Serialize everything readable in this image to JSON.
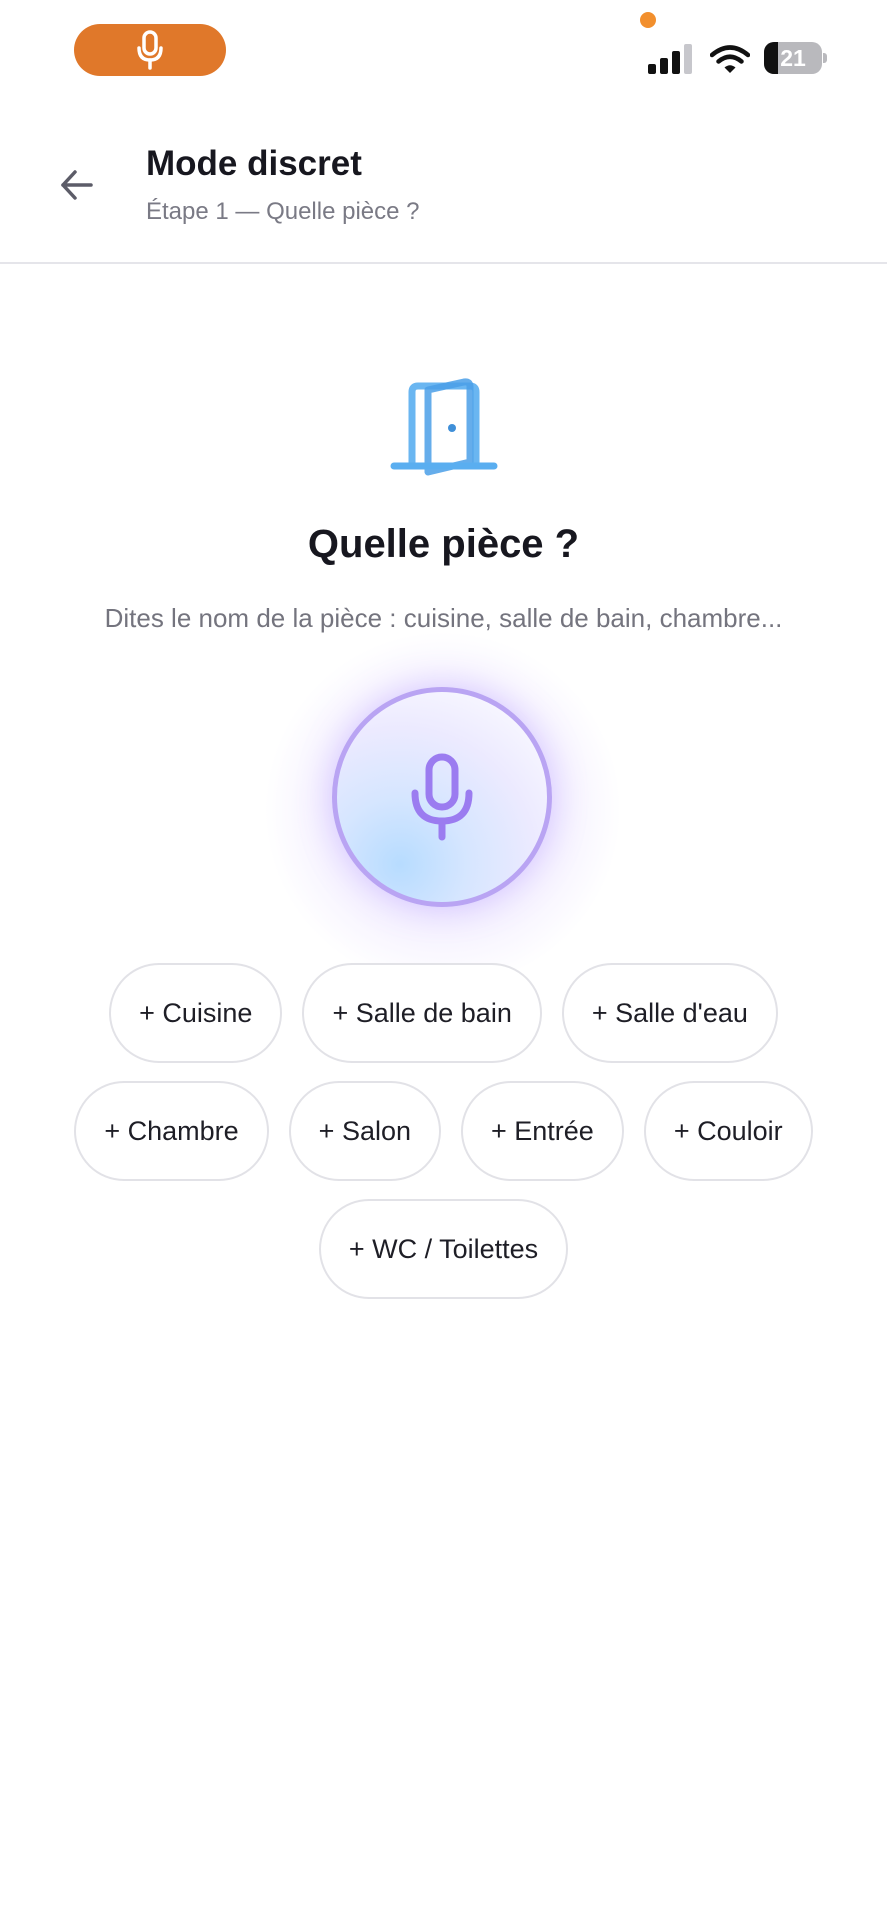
{
  "status_bar": {
    "battery_level": "21",
    "recording_indicator_color": "#e0782a",
    "privacy_dot_color": "#f28f2d",
    "icons": [
      "microphone-icon",
      "cellular-signal-icon",
      "wifi-icon",
      "battery-icon"
    ]
  },
  "header": {
    "title": "Mode discret",
    "subtitle": "Étape 1 — Quelle pièce ?",
    "back_icon": "arrow-left-icon"
  },
  "main": {
    "icon": "door-icon",
    "icon_color": "#5aaef0",
    "question": "Quelle pièce ?",
    "instructions": "Dites le nom de la pièce : cuisine, salle de bain, chambre...",
    "mic_button_icon": "microphone-icon",
    "mic_accent_color": "#9b7cf0"
  },
  "suggestions": [
    [
      "+ Cuisine",
      "+ Salle de bain",
      "+ Salle d'eau"
    ],
    [
      "+ Chambre",
      "+ Salon",
      "+ Entrée",
      "+ Couloir"
    ],
    [
      "+ WC / Toilettes"
    ]
  ]
}
